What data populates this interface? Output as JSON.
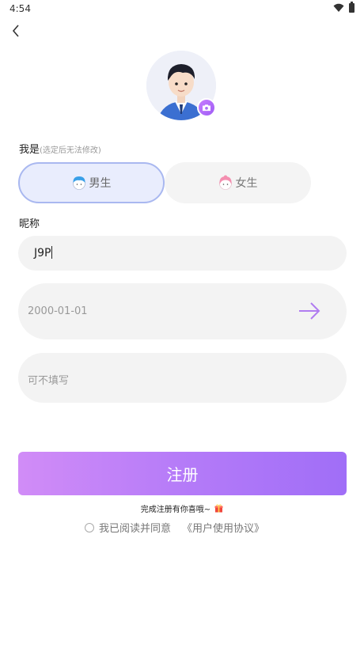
{
  "status": {
    "time": "4:54"
  },
  "gender": {
    "label": "我是",
    "hint": "(选定后无法修改)",
    "male": "男生",
    "female": "女生"
  },
  "nickname": {
    "label": "昵称",
    "value": "J9P"
  },
  "birthday": {
    "value": "2000-01-01"
  },
  "note": {
    "placeholder": "可不填写"
  },
  "register": {
    "label": "注册"
  },
  "gift_text": "完成注册有你喜哦~",
  "agreement": {
    "prefix": "我已阅读并同意",
    "link": "《用户使用协议》"
  },
  "colors": {
    "accent": "#a06ef7",
    "male_bg": "#e9edfd",
    "field_bg": "#f3f3f3"
  }
}
